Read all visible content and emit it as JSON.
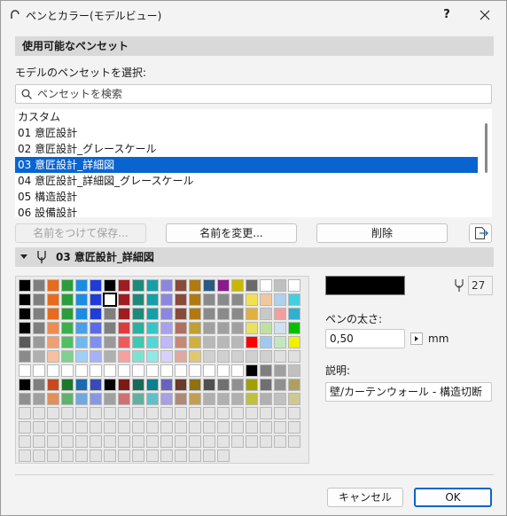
{
  "window": {
    "title": "ペンとカラー(モデルビュー)",
    "help_label": "?"
  },
  "pen_sets_section": {
    "title": "使用可能なペンセット"
  },
  "select_label": "モデルのペンセットを選択:",
  "search": {
    "placeholder": "ペンセットを検索",
    "value": ""
  },
  "pen_sets": [
    {
      "label": "カスタム",
      "selected": false
    },
    {
      "label": "01 意匠設計",
      "selected": false
    },
    {
      "label": "02 意匠設計_グレースケール",
      "selected": false
    },
    {
      "label": "03 意匠設計_詳細図",
      "selected": true
    },
    {
      "label": "04 意匠設計_詳細図_グレースケール",
      "selected": false
    },
    {
      "label": "05 構造設計",
      "selected": false
    },
    {
      "label": "06 設備設計",
      "selected": false
    }
  ],
  "buttons": {
    "save_as": "名前をつけて保存...",
    "rename": "名前を変更...",
    "delete": "削除",
    "cancel": "キャンセル",
    "ok": "OK"
  },
  "pen_set_header": {
    "title": "03 意匠設計_詳細図"
  },
  "palette": {
    "columns": 20,
    "selected_index": 27,
    "rows": [
      [
        "#000000",
        "#7f7f7f",
        "#e86a1c",
        "#2a9e3a",
        "#1c8be0",
        "#1f3bd8",
        "#000000",
        "#a01c20",
        "#1f8a7a",
        "#14a0a8",
        "#8c86e0",
        "#8a4a3a",
        "#b07a10",
        "#2a5a80",
        "#8a1a8a",
        "#c8b800",
        "#6a6a6a",
        "#ffffff",
        "#c0c0c0",
        "#ffffff"
      ],
      [
        "#000000",
        "#7f7f7f",
        "#e86a1c",
        "#2a9e3a",
        "#1c8be0",
        "#1f3bd8",
        "#ffffff",
        "#a01c20",
        "#1f8a7a",
        "#14a0a8",
        "#8c86e0",
        "#8a4a3a",
        "#b07a10",
        "#8a8a8a",
        "#8a8a8a",
        "#8a8a8a",
        "#f3e050",
        "#f0c8a0",
        "#b0d0f0",
        "#40d0e0"
      ],
      [
        "#000000",
        "#7f7f7f",
        "#e86a1c",
        "#2a9e3a",
        "#1c8be0",
        "#1f3bd8",
        "#7f7f7f",
        "#a01c20",
        "#1f8a7a",
        "#14a0a8",
        "#8c86e0",
        "#8a4a3a",
        "#b07a10",
        "#8a8a8a",
        "#8a8a8a",
        "#8a8a8a",
        "#e0b040",
        "#c8c8c8",
        "#f0a0a0",
        "#30b0d0"
      ],
      [
        "#000000",
        "#7f7f7f",
        "#f08a50",
        "#3ab04a",
        "#4aa0e8",
        "#5a6ae8",
        "#7f7f7f",
        "#e03a3a",
        "#2ab0a0",
        "#30c8c8",
        "#a8a0f0",
        "#b07060",
        "#c0a030",
        "#a0a0a0",
        "#a0a0a0",
        "#a0a0a0",
        "#e8e060",
        "#c0e0a0",
        "#d0e0f0",
        "#00c000"
      ],
      [
        "#5a5a5a",
        "#9a9a9a",
        "#f0a070",
        "#50c060",
        "#70b8f0",
        "#8090f0",
        "#9a9a9a",
        "#f05a5a",
        "#40c8b0",
        "#50d8d8",
        "#c0b8f8",
        "#c88878",
        "#d0b040",
        "#b8b8b8",
        "#b8b8b8",
        "#b8b8b8",
        "#ff0000",
        "#a0c8f0",
        "#c0e8c0",
        "#f0f000"
      ],
      [
        "#8a8a8a",
        "#b0b0b0",
        "#f8c0a0",
        "#80d090",
        "#a0d0f8",
        "#a8b0f8",
        "#b0b0b0",
        "#f8a0a0",
        "#80e0d0",
        "#90e8e8",
        "#d8d0ff",
        "#e0a8a0",
        "#e0c870",
        "#d0d0d0",
        "#d0d0d0",
        "#d0d0d0",
        "#d0d0d0",
        "#d0d0d0",
        "#e0e0e0",
        "#e0e0e0"
      ],
      [
        "#ffffff",
        "#ffffff",
        "#ffffff",
        "#ffffff",
        "#ffffff",
        "#ffffff",
        "#ffffff",
        "#ffffff",
        "#ffffff",
        "#ffffff",
        "#ffffff",
        "#ffffff",
        "#ffffff",
        "#ffffff",
        "#ffffff",
        "#ffffff",
        "#000000",
        "#7f7f7f",
        "#a0a0a0",
        "#c0c0c0"
      ],
      [
        "#000000",
        "#7f7f7f",
        "#c84a1c",
        "#1a7a2a",
        "#1a6ab0",
        "#3a4ab8",
        "#000000",
        "#801818",
        "#1a6a5a",
        "#0a8090",
        "#6a62c0",
        "#6a3a2a",
        "#907010",
        "#505050",
        "#707070",
        "#909090",
        "#a0a000",
        "#707070",
        "#909090",
        "#b0a060"
      ],
      [
        "#909090",
        "#a0a0a0",
        "#e0905a",
        "#60b070",
        "#70a8e0",
        "#8898e0",
        "#a0a0a0",
        "#d07070",
        "#60b0a0",
        "#60c0c8",
        "#a8a0e0",
        "#b08878",
        "#c0a050",
        "#b0b0b0",
        "#b0b0b0",
        "#b0b0b0",
        "#c0c040",
        "#b0b0b0",
        "#c0c0c0",
        "#d0c890"
      ],
      [],
      [],
      [],
      []
    ]
  },
  "pen": {
    "color": "#000000",
    "number": "27",
    "weight_label": "ペンの太さ:",
    "weight_value": "0,50",
    "unit": "mm",
    "desc_label": "説明:",
    "description": "壁/カーテンウォール - 構造切断"
  }
}
